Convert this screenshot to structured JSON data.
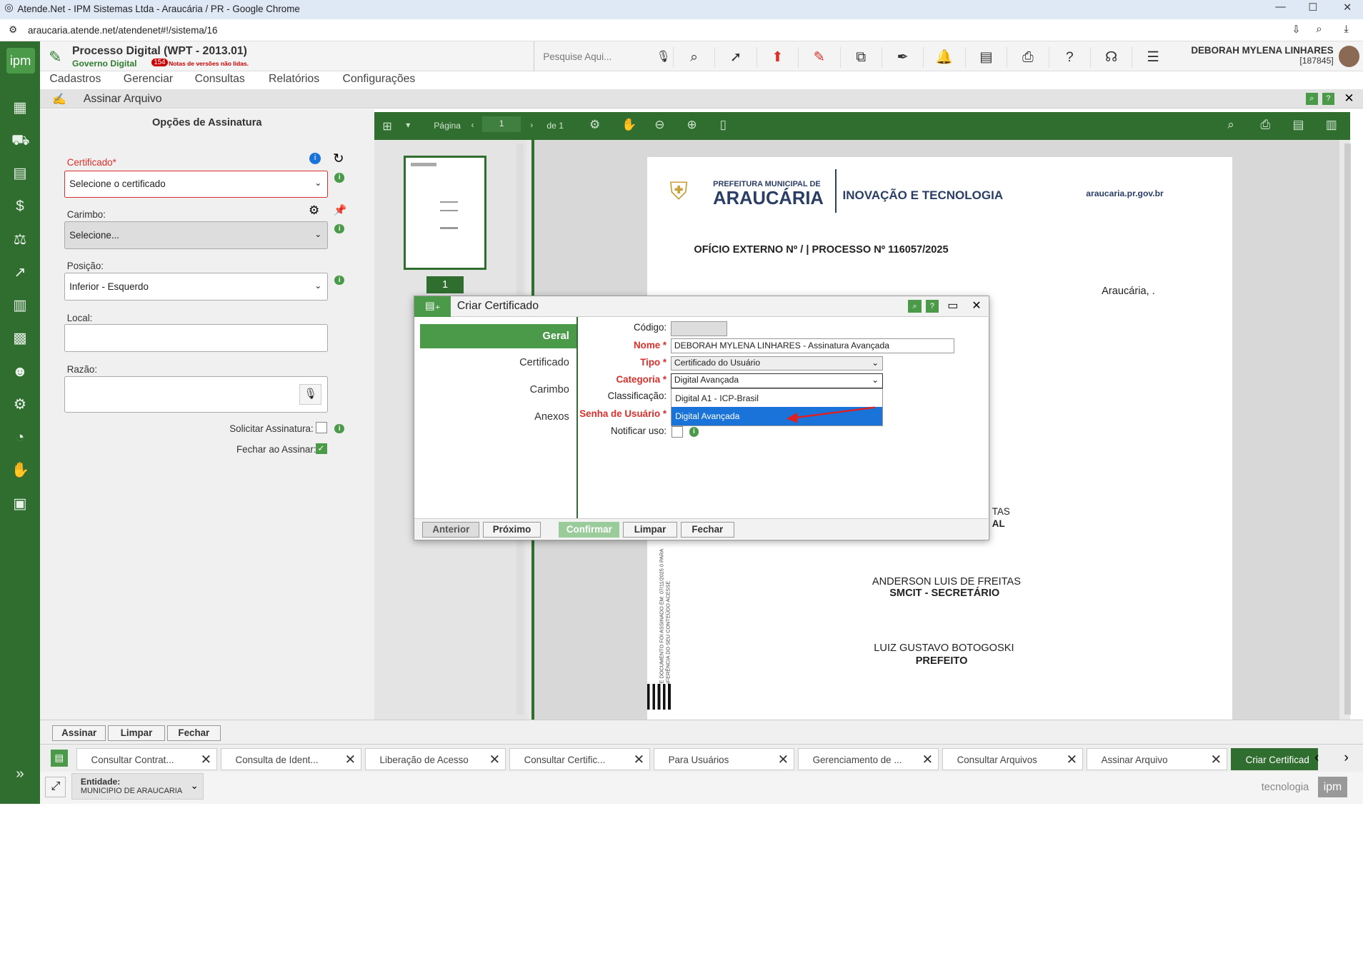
{
  "browser": {
    "title": "Atende.Net - IPM Sistemas Ltda - Araucária / PR - Google Chrome",
    "url": "araucaria.atende.net/atendenet#!/sistema/16"
  },
  "header": {
    "title": "Processo Digital (WPT - 2013.01)",
    "subtitle": "Governo Digital",
    "badge": "154",
    "notice": "Notas de versões não lidas.",
    "search_placeholder": "Pesquise Aqui...",
    "user_name": "DEBORAH MYLENA LINHARES",
    "user_id": "[187845]"
  },
  "menu": [
    "Cadastros",
    "Gerenciar",
    "Consultas",
    "Relatórios",
    "Configurações"
  ],
  "window": {
    "title": "Assinar Arquivo"
  },
  "left": {
    "heading": "Opções de Assinatura",
    "cert_label": "Certificado*",
    "cert_value": "Selecione o certificado",
    "carimbo_label": "Carimbo:",
    "carimbo_value": "Selecione...",
    "posicao_label": "Posição:",
    "posicao_value": "Inferior - Esquerdo",
    "local_label": "Local:",
    "razao_label": "Razão:",
    "solicitar_label": "Solicitar Assinatura:",
    "fechar_label": "Fechar ao Assinar:"
  },
  "viewer": {
    "page_label": "Página",
    "page_value": "1",
    "of_label": "de 1",
    "thumb_num": "1"
  },
  "doc": {
    "pref1": "PREFEITURA MUNICIPAL DE",
    "pref2": "ARAUCÁRIA",
    "inov": "INOVAÇÃO E TECNOLOGIA",
    "site": "araucaria.pr.gov.br",
    "oficio": "OFÍCIO EXTERNO Nº / | PROCESSO Nº 116057/2025",
    "date": "Araucária, .",
    "frag1": "TAS",
    "frag2": "AL",
    "sig1_name": "ANDERSON LUIS DE FREITAS",
    "sig1_role": "SMCIT - SECRETÁRIO",
    "sig2_name": "LUIZ GUSTAVO BOTOGOSKI",
    "sig2_role": "PREFEITO",
    "side_text": "ESTE DOCUMENTO FOI ASSINADO EM: 07/11/2025 0 PARA CONFERÊNCIA DO SEU CONTEÚDO ACESSE"
  },
  "dialog": {
    "title": "Criar Certificado",
    "nav": [
      "Geral",
      "Certificado",
      "Carimbo",
      "Anexos"
    ],
    "codigo_label": "Código:",
    "nome_label": "Nome *",
    "nome_value": "DEBORAH MYLENA LINHARES - Assinatura Avançada",
    "tipo_label": "Tipo *",
    "tipo_value": "Certificado do Usuário",
    "categoria_label": "Categoria *",
    "categoria_value": "Digital Avançada",
    "classificacao_label": "Classificação:",
    "senha_label": "Senha de Usuário *",
    "notificar_label": "Notificar uso:",
    "options": [
      "Digital A1 - ICP-Brasil",
      "Digital Avançada"
    ],
    "buttons": {
      "anterior": "Anterior",
      "proximo": "Próximo",
      "confirmar": "Confirmar",
      "limpar": "Limpar",
      "fechar": "Fechar"
    }
  },
  "bottom": {
    "assinar": "Assinar",
    "limpar": "Limpar",
    "fechar": "Fechar"
  },
  "tabs": [
    "Consultar Contrat...",
    "Consulta de Ident...",
    "Liberação de Acesso",
    "Consultar Certific...",
    "Para Usuários",
    "Gerenciamento de ...",
    "Consultar Arquivos",
    "Assinar Arquivo",
    "Criar Certificad"
  ],
  "footer": {
    "entidade_label": "Entidade:",
    "entidade_value": "MUNICIPIO DE ARAUCARIA",
    "brand": "tecnologia",
    "brand_logo": "ipm"
  },
  "colors": {
    "accent": "#2f6e2f",
    "required": "#d9302c",
    "selected": "#1a73d9"
  }
}
